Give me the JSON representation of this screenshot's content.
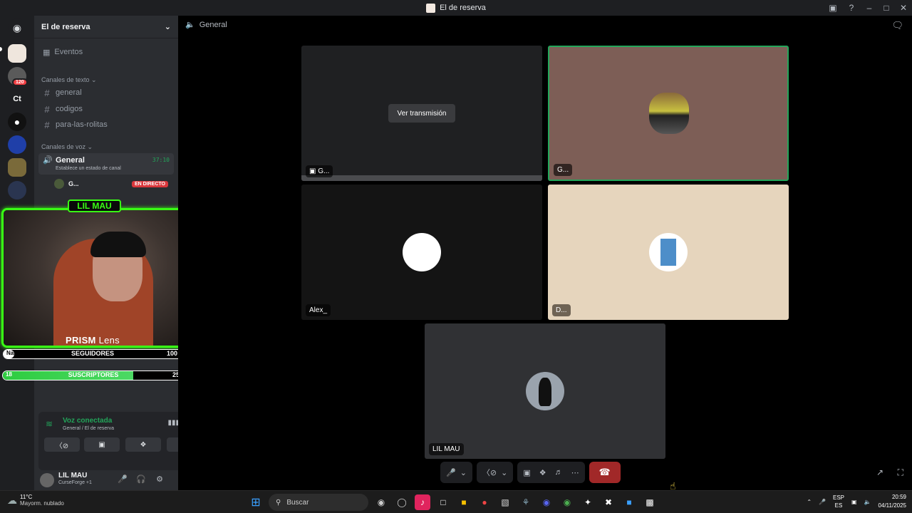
{
  "window": {
    "title": "El de reserva"
  },
  "servers": {
    "badge": "120",
    "ct_label": "Ct"
  },
  "sidebar": {
    "server_name": "El de reserva",
    "events": "Eventos",
    "text_category": "Canales de texto",
    "text_channels": [
      "general",
      "codigos",
      "para-las-rolitas"
    ],
    "voice_category": "Canales de voz",
    "voice_channel": {
      "name": "General",
      "time": "37:10",
      "status": "Establece un estado de canal"
    },
    "voice_user": {
      "name": "G...",
      "live": "EN DIRECTO"
    }
  },
  "overlay": {
    "cam_title": "LIL MAU",
    "brand_bold": "PRISM",
    "brand_light": "Lens",
    "followers": {
      "left": "NaN",
      "label": "SEGUIDORES",
      "right": "100",
      "level": 0.06
    },
    "subs": {
      "left": "18",
      "label": "SUSCRIPTORES",
      "right": "25",
      "level": 0.72
    }
  },
  "voice_panel": {
    "status": "Voz conectada",
    "location": "General / El de reserva"
  },
  "userbar": {
    "name": "LIL MAU",
    "activity": "CurseForge +1"
  },
  "main": {
    "channel": "General",
    "watch_button": "Ver transmisión",
    "tiles": [
      {
        "label": "G..."
      },
      {
        "label": "G..."
      },
      {
        "label": "Alex_"
      },
      {
        "label": "D..."
      },
      {
        "label": "LIL MAU"
      }
    ]
  },
  "taskbar": {
    "temp": "11°C",
    "weather": "Mayorm. nublado",
    "search_placeholder": "Buscar",
    "lang1": "ESP",
    "lang2": "ES",
    "time": "20:59",
    "date": "04/11/2025"
  },
  "colors": {
    "accent_green": "#39ff14",
    "voice_green": "#23a55a",
    "hangup_red": "#a12828",
    "live_red": "#da373c"
  }
}
